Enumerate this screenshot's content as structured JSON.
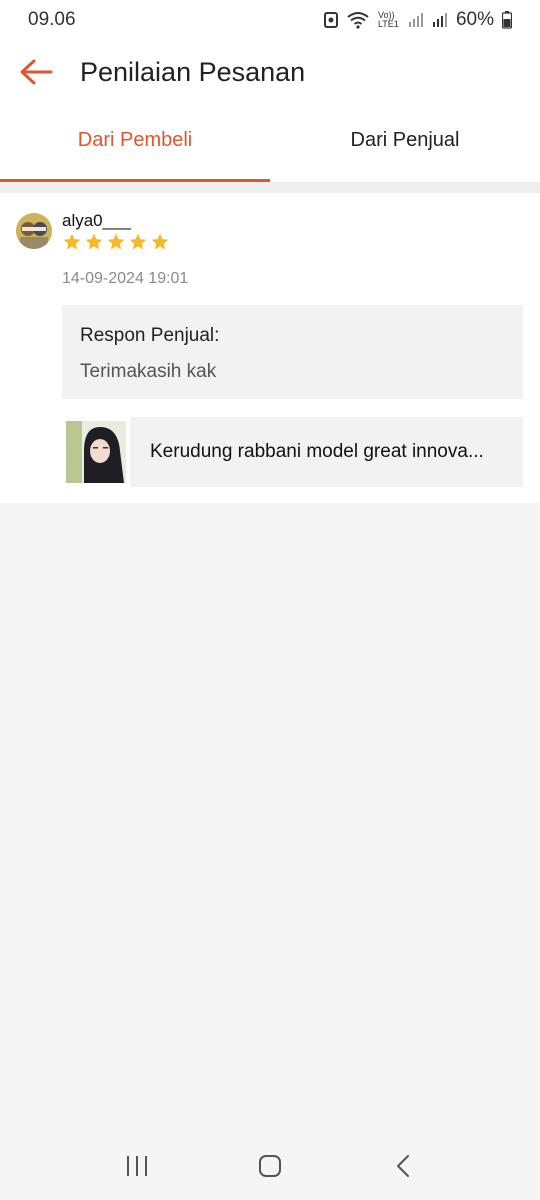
{
  "status_bar": {
    "time": "09.06",
    "network_label": "Vo)) LTE1",
    "battery": "60%"
  },
  "header": {
    "title": "Penilaian Pesanan"
  },
  "tabs": [
    {
      "label": "Dari Pembeli",
      "active": true
    },
    {
      "label": "Dari Penjual",
      "active": false
    }
  ],
  "review": {
    "username": "alya0___",
    "rating": 5,
    "max_rating": 5,
    "date": "14-09-2024 19:01",
    "seller_response_label": "Respon Penjual:",
    "seller_response_text": "Terimakasih kak",
    "product_name": "Kerudung rabbani model great innova..."
  },
  "colors": {
    "accent": "#e0552e",
    "star": "#f6b92b"
  }
}
